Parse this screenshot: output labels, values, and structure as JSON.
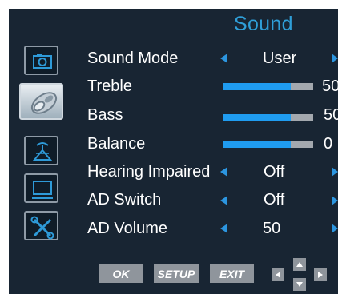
{
  "header": {
    "title": "Sound"
  },
  "sidebar": {
    "icons": [
      {
        "name": "picture-icon"
      },
      {
        "name": "sound-icon"
      },
      {
        "name": "channel-icon"
      },
      {
        "name": "screen-icon"
      },
      {
        "name": "setup-tools-icon"
      }
    ],
    "active_index": 1
  },
  "menu": {
    "sound_mode": {
      "label": "Sound Mode",
      "value": "User"
    },
    "treble": {
      "label": "Treble",
      "value": "50",
      "level": 0.75
    },
    "bass": {
      "label": "Bass",
      "value": "50",
      "level": 0.75
    },
    "balance": {
      "label": "Balance",
      "value": "0",
      "level": 0.75
    },
    "hearing_impaired": {
      "label": "Hearing Impaired",
      "value": "Off"
    },
    "ad_switch": {
      "label": "AD Switch",
      "value": "Off"
    },
    "ad_volume": {
      "label": "AD Volume",
      "value": "50"
    }
  },
  "footer": {
    "ok": "OK",
    "setup": "SETUP",
    "exit": "EXIT"
  },
  "colors": {
    "accent": "#2f9fd8",
    "panel": "#182533",
    "slider_fill": "#1f9cf0",
    "slider_track": "#a3a8ae",
    "button": "#8f959c"
  }
}
